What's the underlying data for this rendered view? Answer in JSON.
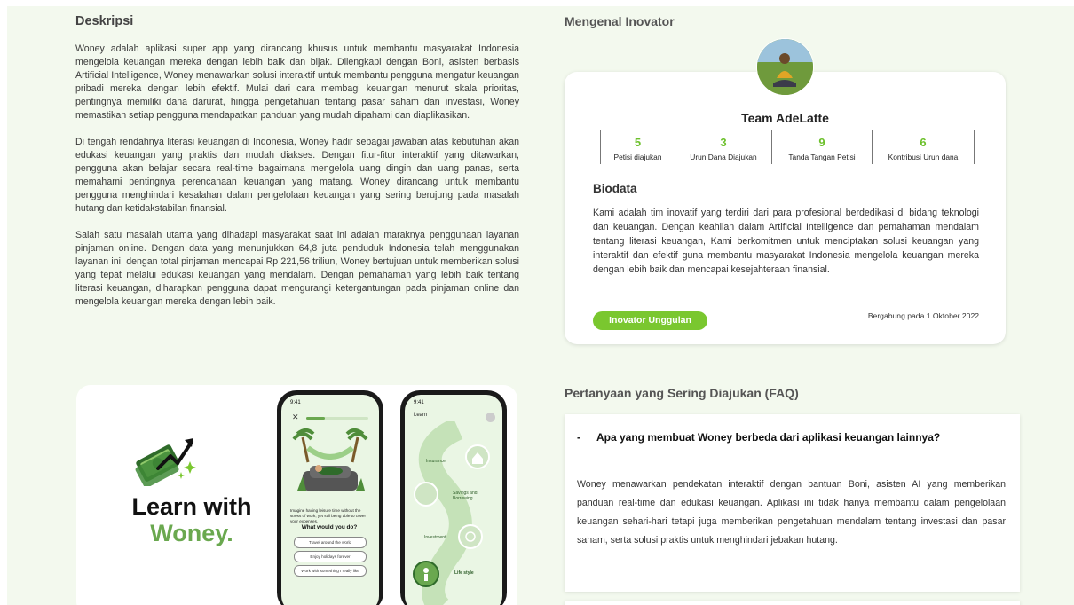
{
  "description": {
    "heading": "Deskripsi",
    "paragraphs": [
      "Woney adalah aplikasi super app yang dirancang khusus untuk membantu masyarakat Indonesia mengelola keuangan mereka dengan lebih baik dan bijak. Dilengkapi dengan Boni, asisten berbasis Artificial Intelligence, Woney menawarkan solusi interaktif untuk membantu pengguna mengatur keuangan pribadi mereka dengan lebih efektif. Mulai dari cara membagi keuangan menurut skala prioritas, pentingnya memiliki dana darurat, hingga pengetahuan tentang pasar saham dan investasi, Woney memastikan setiap pengguna mendapatkan panduan yang mudah dipahami dan diaplikasikan.",
      "Di tengah rendahnya literasi keuangan di Indonesia, Woney hadir sebagai jawaban atas kebutuhan akan edukasi keuangan yang praktis dan mudah diakses. Dengan fitur-fitur interaktif yang ditawarkan, pengguna akan belajar secara real-time bagaimana mengelola uang dingin dan uang panas, serta memahami pentingnya perencanaan keuangan yang matang. Woney dirancang untuk membantu pengguna menghindari kesalahan dalam pengelolaan keuangan yang sering berujung pada masalah hutang dan ketidakstabilan finansial.",
      "Salah satu masalah utama yang dihadapi masyarakat saat ini adalah maraknya penggunaan layanan pinjaman online. Dengan data yang menunjukkan 64,8 juta penduduk Indonesia telah menggunakan layanan ini, dengan total pinjaman mencapai Rp 221,56 triliun, Woney bertujuan untuk memberikan solusi yang tepat melalui edukasi keuangan yang mendalam. Dengan pemahaman yang lebih baik tentang literasi keuangan, diharapkan pengguna dapat mengurangi ketergantungan pada pinjaman online dan mengelola keuangan mereka dengan lebih baik."
    ]
  },
  "promo": {
    "title": "Learn with",
    "subtitle": "Woney.",
    "phone1": {
      "status_time": "9:41",
      "prompt": "Imagine having leisure time without the stress of work, yet still being able to cover your expenses.",
      "question": "What would you do?",
      "options": [
        "Travel around the world",
        "Enjoy holidays forever",
        "Work with something I really like"
      ]
    },
    "phone2": {
      "status_time": "9:41",
      "header": "Learn",
      "nodes": [
        "Insurance",
        "Savings and Borrowing",
        "Investment",
        "Life style"
      ]
    }
  },
  "innovator": {
    "heading": "Mengenal Inovator",
    "team_name": "Team AdeLatte",
    "stats": [
      {
        "value": "5",
        "label": "Petisi diajukan"
      },
      {
        "value": "3",
        "label": "Urun Dana Diajukan"
      },
      {
        "value": "9",
        "label": "Tanda Tangan Petisi"
      },
      {
        "value": "6",
        "label": "Kontribusi Urun dana"
      }
    ],
    "bio_heading": "Biodata",
    "bio": "Kami adalah tim inovatif yang terdiri dari para profesional berdedikasi di bidang teknologi dan keuangan. Dengan keahlian dalam Artificial Intelligence dan pemahaman mendalam tentang literasi keuangan, Kami berkomitmen untuk menciptakan solusi keuangan yang interaktif dan efektif guna membantu masyarakat Indonesia mengelola keuangan mereka dengan lebih baik dan mencapai kesejahteraan finansial.",
    "badge": "Inovator Unggulan",
    "joined": "Bergabung pada 1 Oktober 2022"
  },
  "faq": {
    "heading": "Pertanyaan yang Sering Diajukan (FAQ)",
    "items": [
      {
        "toggle": "-",
        "question": "Apa yang membuat Woney berbeda dari aplikasi keuangan lainnya?",
        "answer": "Woney menawarkan pendekatan interaktif dengan bantuan Boni, asisten AI yang memberikan panduan real-time dan edukasi keuangan. Aplikasi ini tidak hanya membantu dalam pengelolaan keuangan sehari-hari tetapi juga memberikan pengetahuan mendalam tentang investasi dan pasar saham, serta solusi praktis untuk menghindari jebakan hutang."
      }
    ]
  },
  "colors": {
    "accent_green": "#7ac72f",
    "stat_green": "#6cc02b",
    "brand_green": "#6aa84f",
    "page_bg": "#f3f9ee"
  }
}
